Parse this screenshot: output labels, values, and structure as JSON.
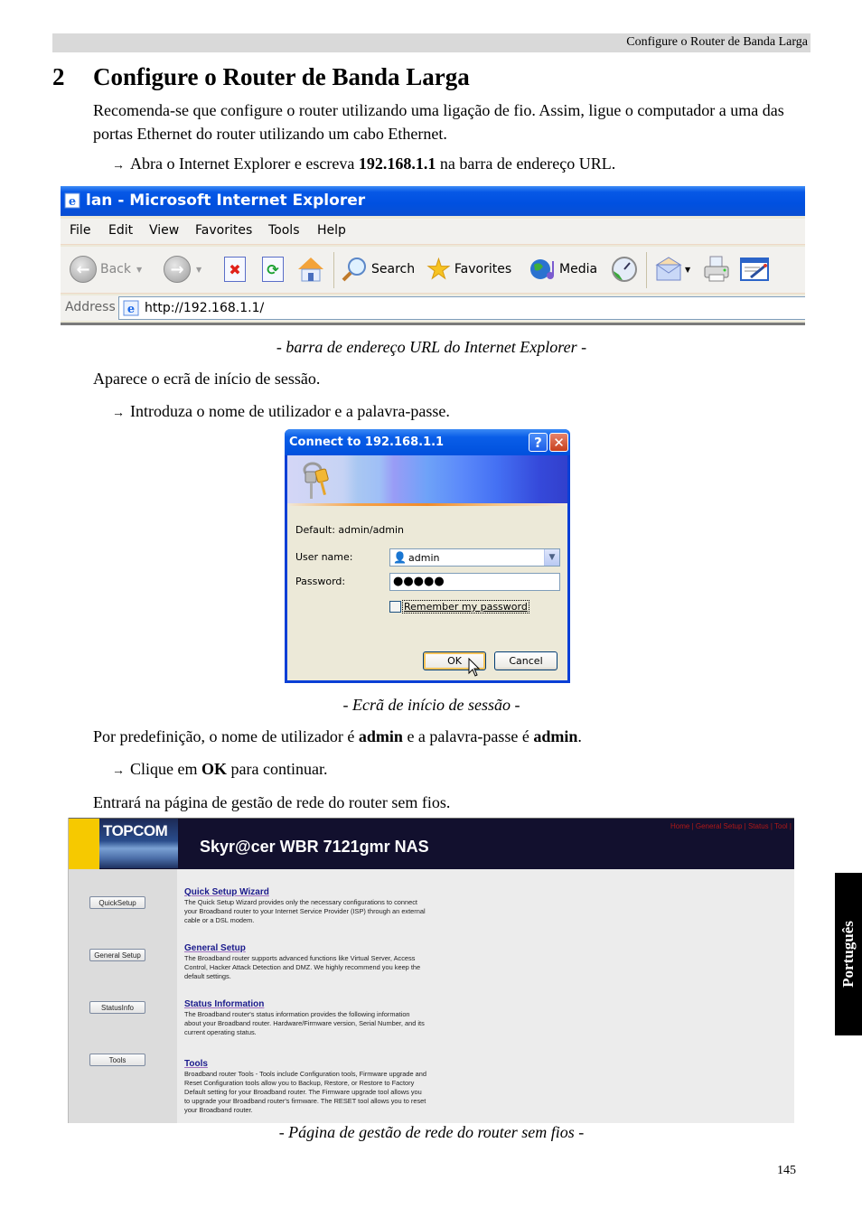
{
  "running_header": "Configure o Router de Banda Larga",
  "section": {
    "number": "2",
    "title": "Configure o Router de Banda Larga"
  },
  "paragraphs": {
    "intro": "Recomenda-se que configure o router utilizando uma ligação de fio. Assim, ligue o computador a uma das portas Ethernet do router utilizando um cabo Ethernet.",
    "step1_pre": "Abra o Internet Explorer e escreva ",
    "step1_bold": "192.168.1.1",
    "step1_post": " na barra de endereço URL.",
    "caption1": "- barra de endereço URL do Internet Explorer -",
    "login_appears": "Aparece o ecrã de início de sessão.",
    "step2": "Introduza o nome de utilizador e a palavra-passe.",
    "caption2": "- Ecrã de início de sessão -",
    "default_pre": "Por predefinição, o nome de utilizador é ",
    "default_user": "admin",
    "default_mid": " e a palavra-passe é ",
    "default_pass": "admin",
    "default_post": ".",
    "step3_pre": "Clique em ",
    "step3_bold": "OK",
    "step3_post": " para continuar.",
    "enter_page": "Entrará na página de gestão de rede do router sem fios.",
    "caption3": "- Página de gestão de rede do router sem fios -"
  },
  "bullet_arrow": "→",
  "ie_window": {
    "title": "lan - Microsoft Internet Explorer",
    "menu": [
      "File",
      "Edit",
      "View",
      "Favorites",
      "Tools",
      "Help"
    ],
    "toolbar": {
      "back": "Back",
      "search": "Search",
      "favorites": "Favorites",
      "media": "Media"
    },
    "address_label": "Address",
    "address_value": "http://192.168.1.1/"
  },
  "login_dialog": {
    "title": "Connect to 192.168.1.1",
    "help_glyph": "?",
    "close_glyph": "✕",
    "default_text": "Default: admin/admin",
    "username_label": "User name:",
    "username_value": "admin",
    "password_label": "Password:",
    "password_mask": "●●●●●",
    "remember_label": "Remember my password",
    "remember_checked": false,
    "ok_label": "OK",
    "cancel_label": "Cancel"
  },
  "router_page": {
    "logo": "TOPCOM",
    "product": "Skyr@cer WBR 7121gmr NAS",
    "top_nav": "Home | General Setup | Status | Tool |",
    "side_buttons": [
      "QuickSetup",
      "General Setup",
      "StatusInfo",
      "Tools"
    ],
    "sections": [
      {
        "title": "Quick Setup Wizard",
        "desc": "The Quick Setup Wizard provides only the necessary configurations to connect your Broadband router to your Internet Service Provider (ISP) through an external cable or a DSL modem."
      },
      {
        "title": "General Setup",
        "desc": "The Broadband router supports advanced functions like Virtual Server, Access Control, Hacker Attack Detection and DMZ. We highly recommend you keep the default settings."
      },
      {
        "title": "Status Information",
        "desc": "The Broadband router's status information provides the following information about your Broadband router. Hardware/Firmware version, Serial Number, and its current operating status."
      },
      {
        "title": "Tools",
        "desc": "Broadband router Tools - Tools include Configuration tools, Firmware upgrade and Reset Configuration tools allow you to Backup, Restore, or Restore to Factory Default setting for your Broadband router. The Firmware upgrade tool allows you to upgrade your Broadband router's firmware. The RESET tool allows you to reset your Broadband router."
      }
    ]
  },
  "side_tab": "Português",
  "page_number": "145"
}
